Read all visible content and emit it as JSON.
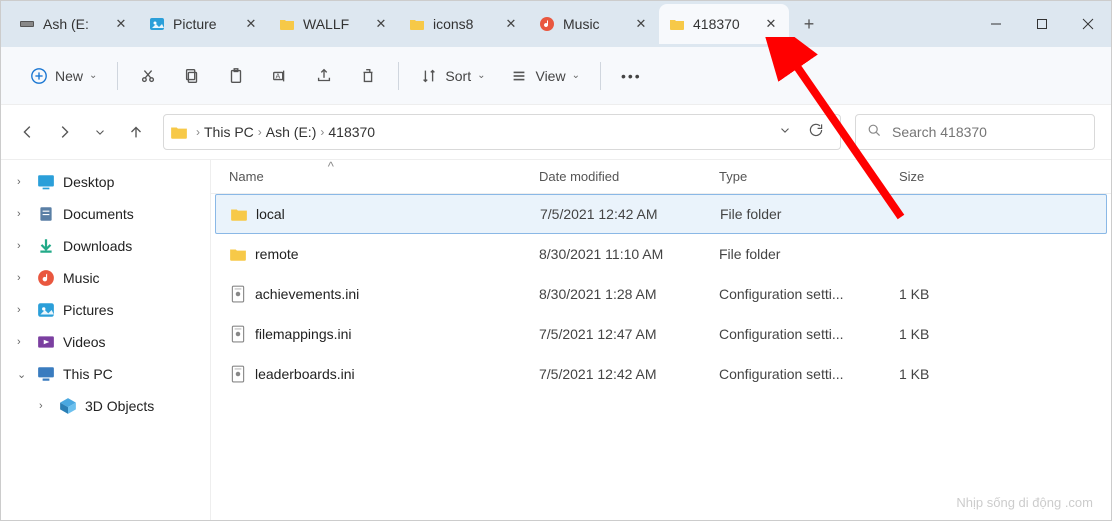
{
  "tabs": [
    {
      "label": "Ash (E:"
    },
    {
      "label": "Picture"
    },
    {
      "label": "WALLF"
    },
    {
      "label": "icons8"
    },
    {
      "label": "Music"
    },
    {
      "label": "418370"
    }
  ],
  "toolbar": {
    "new_label": "New",
    "sort_label": "Sort",
    "view_label": "View"
  },
  "breadcrumb": {
    "items": [
      "This PC",
      "Ash (E:)",
      "418370"
    ]
  },
  "search": {
    "placeholder": "Search 418370"
  },
  "sidebar": [
    {
      "label": "Desktop",
      "icon": "desktop",
      "chev": ">"
    },
    {
      "label": "Documents",
      "icon": "docs",
      "chev": ">"
    },
    {
      "label": "Downloads",
      "icon": "downloads",
      "chev": ">"
    },
    {
      "label": "Music",
      "icon": "music",
      "chev": ">"
    },
    {
      "label": "Pictures",
      "icon": "pictures",
      "chev": ">"
    },
    {
      "label": "Videos",
      "icon": "videos",
      "chev": ">"
    },
    {
      "label": "This PC",
      "icon": "thispc",
      "chev": "v"
    },
    {
      "label": "3D Objects",
      "icon": "3d",
      "chev": ">",
      "sub": true
    }
  ],
  "columns": {
    "name": "Name",
    "date": "Date modified",
    "type": "Type",
    "size": "Size"
  },
  "files": [
    {
      "name": "local",
      "date": "7/5/2021 12:42 AM",
      "type": "File folder",
      "size": "",
      "kind": "folder",
      "selected": true
    },
    {
      "name": "remote",
      "date": "8/30/2021 11:10 AM",
      "type": "File folder",
      "size": "",
      "kind": "folder"
    },
    {
      "name": "achievements.ini",
      "date": "8/30/2021 1:28 AM",
      "type": "Configuration setti...",
      "size": "1 KB",
      "kind": "ini"
    },
    {
      "name": "filemappings.ini",
      "date": "7/5/2021 12:47 AM",
      "type": "Configuration setti...",
      "size": "1 KB",
      "kind": "ini"
    },
    {
      "name": "leaderboards.ini",
      "date": "7/5/2021 12:42 AM",
      "type": "Configuration setti...",
      "size": "1 KB",
      "kind": "ini"
    }
  ],
  "watermark": "Nhịp sống di động .com"
}
